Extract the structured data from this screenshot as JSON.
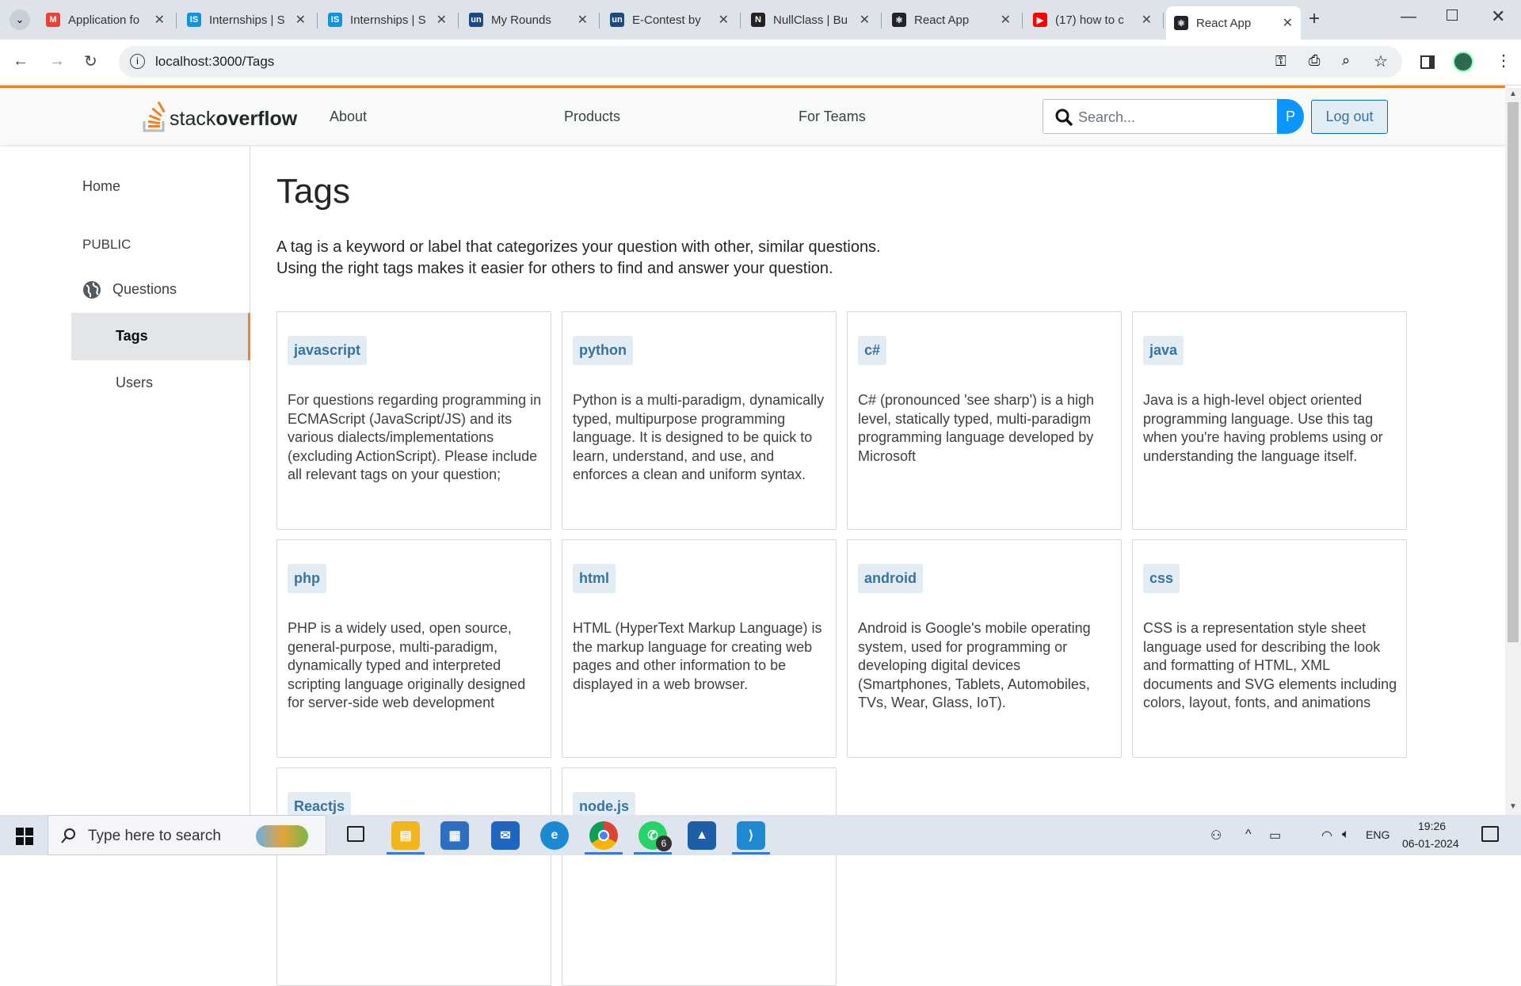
{
  "browser": {
    "tabs": [
      {
        "title": "Application fo",
        "icon": "gmail-icon",
        "color": "#ea4335",
        "glyph": "M"
      },
      {
        "title": "Internships | S",
        "icon": "internshala-icon",
        "color": "#1295d8",
        "glyph": "IS"
      },
      {
        "title": "Internships | S",
        "icon": "internshala-icon",
        "color": "#1295d8",
        "glyph": "IS"
      },
      {
        "title": "My Rounds",
        "icon": "unstop-icon",
        "color": "#1c4980",
        "glyph": "un"
      },
      {
        "title": "E-Contest by",
        "icon": "unstop-icon",
        "color": "#1c4980",
        "glyph": "un"
      },
      {
        "title": "NullClass | Bu",
        "icon": "nullclass-icon",
        "color": "#222222",
        "glyph": "N"
      },
      {
        "title": "React App",
        "icon": "react-icon",
        "color": "#20232a",
        "glyph": "⚛"
      },
      {
        "title": "(17) how to c",
        "icon": "youtube-icon",
        "color": "#ff0000",
        "glyph": "▶"
      },
      {
        "title": "React App",
        "icon": "react-icon",
        "color": "#20232a",
        "glyph": "⚛"
      }
    ],
    "url": "localhost:3000/Tags"
  },
  "nav": {
    "logo_text_1": "stack",
    "logo_text_2": "overflow",
    "links": [
      "About",
      "Products",
      "For Teams"
    ],
    "search_placeholder": "Search...",
    "avatar_letter": "P",
    "logout": "Log out"
  },
  "sidebar": {
    "home": "Home",
    "public": "PUBLIC",
    "questions": "Questions",
    "tags": "Tags",
    "users": "Users"
  },
  "main": {
    "title": "Tags",
    "intro_1": "A tag is a keyword or label that categorizes your question with other, similar questions.",
    "intro_2": "Using the right tags makes it easier for others to find and answer your question.",
    "tags": [
      {
        "name": "javascript",
        "desc": "For questions regarding programming in ECMAScript (JavaScript/JS) and its various dialects/implementations (excluding ActionScript). Please include all relevant tags on your question;"
      },
      {
        "name": "python",
        "desc": "Python is a multi-paradigm, dynamically typed, multipurpose programming language. It is designed to be quick to learn, understand, and use, and enforces a clean and uniform syntax."
      },
      {
        "name": "c#",
        "desc": "C# (pronounced 'see sharp') is a high level, statically typed, multi-paradigm programming language developed by Microsoft"
      },
      {
        "name": "java",
        "desc": "Java is a high-level object oriented programming language. Use this tag when you're having problems using or understanding the language itself."
      },
      {
        "name": "php",
        "desc": "PHP is a widely used, open source, general-purpose, multi-paradigm, dynamically typed and interpreted scripting language originally designed for server-side web development"
      },
      {
        "name": "html",
        "desc": "HTML (HyperText Markup Language) is the markup language for creating web pages and other information to be displayed in a web browser."
      },
      {
        "name": "android",
        "desc": "Android is Google's mobile operating system, used for programming or developing digital devices (Smartphones, Tablets, Automobiles, TVs, Wear, Glass, IoT)."
      },
      {
        "name": "css",
        "desc": "CSS is a representation style sheet language used for describing the look and formatting of HTML, XML documents and SVG elements including colors, layout, fonts, and animations"
      },
      {
        "name": "Reactjs",
        "desc": ""
      },
      {
        "name": "node.js",
        "desc": ""
      }
    ]
  },
  "taskbar": {
    "search_placeholder": "Type here to search",
    "whatsapp_badge": "6",
    "lang": "ENG",
    "time": "19:26",
    "date": "06-01-2024"
  }
}
